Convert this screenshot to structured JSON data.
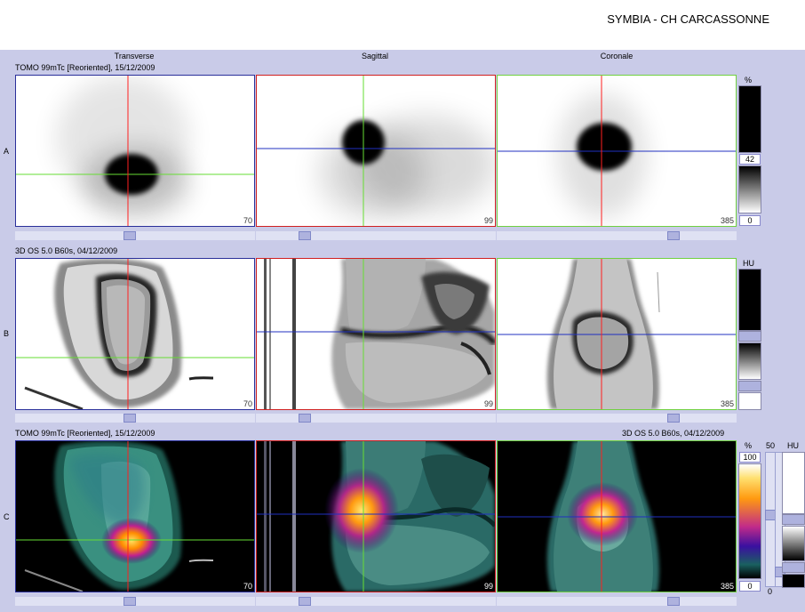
{
  "header": {
    "hospital": "SYMBIA - CH CARCASSONNE"
  },
  "columns": {
    "transverse": "Transverse",
    "sagittal": "Sagittal",
    "coronal": "Coronale"
  },
  "rows": {
    "a": {
      "letter": "A",
      "info": "TOMO 99mTc [Reoriented], 15/12/2009"
    },
    "b": {
      "letter": "B",
      "info": "3D  OS  5.0  B60s, 04/12/2009"
    },
    "c": {
      "letter": "C",
      "info_left": "TOMO 99mTc [Reoriented], 15/12/2009",
      "info_right": "3D  OS  5.0  B60s, 04/12/2009"
    }
  },
  "slices": {
    "transverse": "70",
    "sagittal": "99",
    "coronal": "385"
  },
  "scales": {
    "a": {
      "unit": "%",
      "max": "42",
      "min": "0"
    },
    "b": {
      "unit": "HU"
    },
    "c": {
      "unit_pct": "%",
      "max_pct": "100",
      "min_pct": "0",
      "value_50": "50",
      "unit_hu": "HU",
      "min_hu": "0"
    }
  },
  "colors": {
    "workspace": "#c9cbe8",
    "crosshair_red": "#ff2020",
    "crosshair_green": "#66dd33",
    "crosshair_blue": "#2030c0",
    "frame_blue": "#2a2f9a",
    "frame_red": "#d02020",
    "frame_green": "#70d040"
  }
}
